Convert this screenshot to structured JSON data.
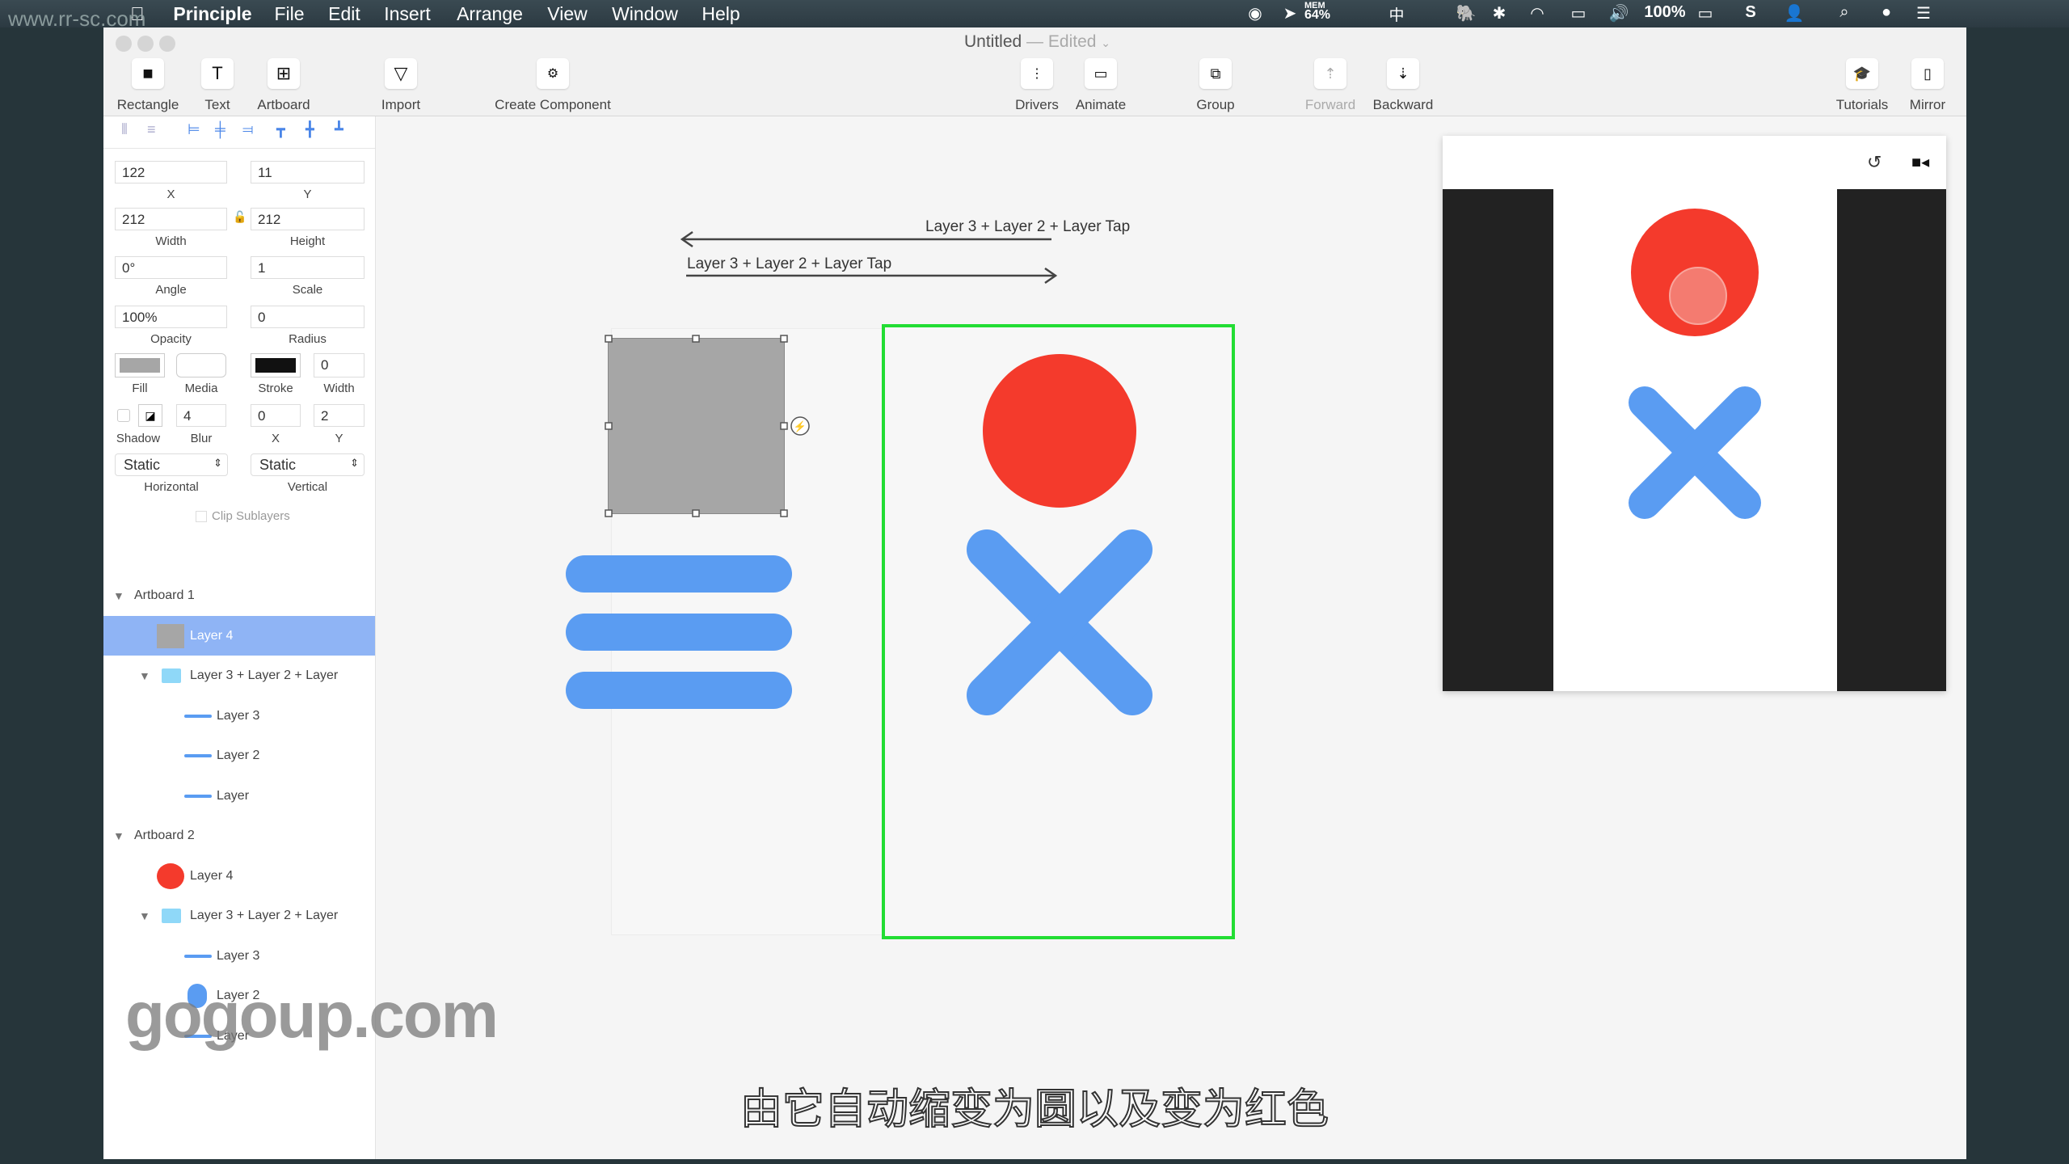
{
  "watermark_site": "www.rr-sc.com",
  "watermark_brand": "gogoup.com",
  "menubar": {
    "app": "Principle",
    "items": [
      "File",
      "Edit",
      "Insert",
      "Arrange",
      "View",
      "Window",
      "Help"
    ],
    "status": {
      "mem_label": "MEM",
      "mem_value": "64%",
      "battery": "100%",
      "input": "中"
    }
  },
  "window": {
    "title": "Untitled",
    "edited": "— Edited"
  },
  "toolbar": {
    "rectangle": "Rectangle",
    "text": "Text",
    "artboard": "Artboard",
    "import": "Import",
    "create_component": "Create Component",
    "drivers": "Drivers",
    "animate": "Animate",
    "group": "Group",
    "forward": "Forward",
    "backward": "Backward",
    "tutorials": "Tutorials",
    "mirror": "Mirror"
  },
  "inspector": {
    "x": "122",
    "x_label": "X",
    "y": "11",
    "y_label": "Y",
    "width": "212",
    "width_label": "Width",
    "height": "212",
    "height_label": "Height",
    "angle": "0°",
    "angle_label": "Angle",
    "scale": "1",
    "scale_label": "Scale",
    "opacity": "100%",
    "opacity_label": "Opacity",
    "radius": "0",
    "radius_label": "Radius",
    "fill_label": "Fill",
    "media_label": "Media",
    "stroke_label": "Stroke",
    "stroke_width": "0",
    "stroke_width_label": "Width",
    "fill_color": "#a6a6a6",
    "stroke_color": "#111111",
    "shadow_label": "Shadow",
    "blur": "4",
    "blur_label": "Blur",
    "shadow_x": "0",
    "shadow_x_label": "X",
    "shadow_y": "2",
    "shadow_y_label": "Y",
    "horizontal": "Static",
    "horizontal_label": "Horizontal",
    "vertical": "Static",
    "vertical_label": "Vertical",
    "clip_sublayers": "Clip Sublayers"
  },
  "layers": [
    {
      "label": "Artboard 1",
      "type": "artboard"
    },
    {
      "label": "Layer 4",
      "type": "gray-rect",
      "selected": true
    },
    {
      "label": "Layer 3 + Layer 2 + Layer",
      "type": "group"
    },
    {
      "label": "Layer 3",
      "type": "line"
    },
    {
      "label": "Layer 2",
      "type": "line"
    },
    {
      "label": "Layer",
      "type": "line"
    },
    {
      "label": "Artboard 2",
      "type": "artboard"
    },
    {
      "label": "Layer 4",
      "type": "red-circle"
    },
    {
      "label": "Layer 3 + Layer 2 + Layer",
      "type": "group"
    },
    {
      "label": "Layer 3",
      "type": "line"
    },
    {
      "label": "Layer 2",
      "type": "blue-pill"
    },
    {
      "label": "Layer",
      "type": "line"
    }
  ],
  "canvas": {
    "transition_back": "Layer 3 + Layer 2 + Layer Tap",
    "transition_forward": "Layer 3 + Layer 2 + Layer Tap",
    "colors": {
      "red": "#f43a2c",
      "blue": "#5a9cf2",
      "selected_border": "#22dd33",
      "gray": "#a6a6a6"
    }
  },
  "subtitle": "由它自动缩变为圆以及变为红色"
}
